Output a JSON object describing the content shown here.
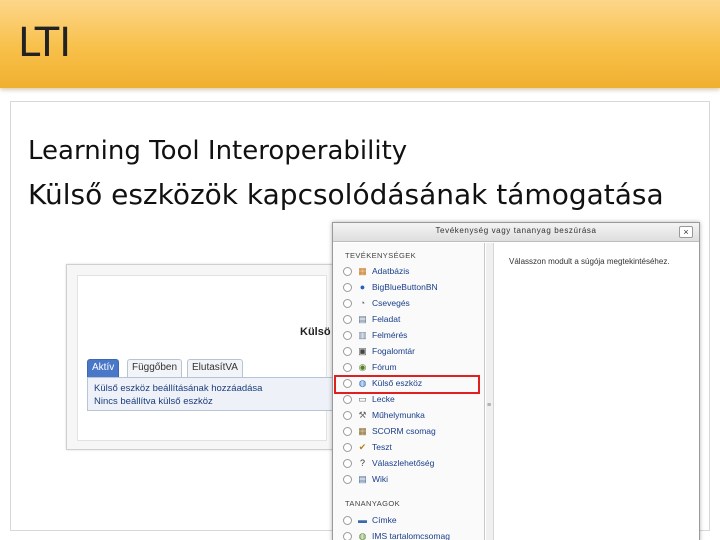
{
  "slide": {
    "title": "LTI",
    "subtitle_line1": "Learning Tool Interoperability",
    "subtitle_line2": "Külső eszközök kapcsolódásának támogatása"
  },
  "background_screen": {
    "heading": "Külsö",
    "tabs": [
      {
        "label": "Aktív",
        "active": true
      },
      {
        "label": "Függőben",
        "active": false
      },
      {
        "label": "ElutasítVA",
        "active": false
      }
    ],
    "lines": [
      "Külső eszköz beállításának hozzáadása",
      "Nincs beállítva külső eszköz"
    ]
  },
  "modal": {
    "title": "Tevékenység vagy tananyag beszúrása",
    "close_label": "×",
    "help_text": "Válasszon modult a súgója megtekintéséhez.",
    "scroll_marker": "≡",
    "activities_heading": "TEVÉKENYSÉGEK",
    "resources_heading": "TANANYAGOK",
    "activities": [
      {
        "label": "Adatbázis",
        "icon": "database-icon",
        "glyph": "▦",
        "color": "#c9741c"
      },
      {
        "label": "BigBlueButtonBN",
        "icon": "bigbluebutton-icon",
        "glyph": "●",
        "color": "#2a5fb8"
      },
      {
        "label": "Csevegés",
        "icon": "chat-icon",
        "glyph": "◔",
        "color": "#6a6a6a"
      },
      {
        "label": "Feladat",
        "icon": "assignment-icon",
        "glyph": "▤",
        "color": "#5a6f8c"
      },
      {
        "label": "Felmérés",
        "icon": "survey-icon",
        "glyph": "▥",
        "color": "#6b7fa0"
      },
      {
        "label": "Fogalomtár",
        "icon": "glossary-icon",
        "glyph": "▣",
        "color": "#444444"
      },
      {
        "label": "Fórum",
        "icon": "forum-icon",
        "glyph": "◉",
        "color": "#5a7f2a"
      },
      {
        "label": "Külső eszköz",
        "icon": "external-tool-icon",
        "glyph": "◍",
        "color": "#2c6fc4"
      },
      {
        "label": "Lecke",
        "icon": "lesson-icon",
        "glyph": "▭",
        "color": "#6a6a6a"
      },
      {
        "label": "Műhelymunka",
        "icon": "workshop-icon",
        "glyph": "⚒",
        "color": "#6a6a6a"
      },
      {
        "label": "SCORM csomag",
        "icon": "scorm-icon",
        "glyph": "▦",
        "color": "#8a6a2a"
      },
      {
        "label": "Teszt",
        "icon": "quiz-icon",
        "glyph": "✔",
        "color": "#b08010"
      },
      {
        "label": "Válaszlehetőség",
        "icon": "choice-icon",
        "glyph": "?",
        "color": "#333333"
      },
      {
        "label": "Wiki",
        "icon": "wiki-icon",
        "glyph": "▤",
        "color": "#4a6a9a"
      }
    ],
    "resources": [
      {
        "label": "Címke",
        "icon": "label-icon",
        "glyph": "▬",
        "color": "#3a6aaa"
      },
      {
        "label": "IMS tartalomcsomag",
        "icon": "ims-package-icon",
        "glyph": "◍",
        "color": "#5a8a2a"
      }
    ],
    "highlighted_item": "Külső eszköz",
    "highlight_color": "#e02020"
  }
}
